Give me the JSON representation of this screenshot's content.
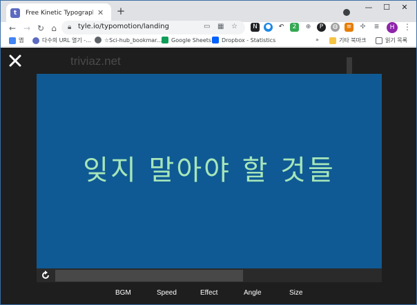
{
  "browser": {
    "tab_title": "Free Kinetic Typography Vid",
    "tab_favicon_letter": "t",
    "new_tab_label": "+",
    "url": "tyle.io/typomotion/landing",
    "avatar_letter": "H",
    "badge_count": "2"
  },
  "bookmarks": [
    {
      "label": "앱",
      "icon": "apps-icon",
      "color": "#4285f4"
    },
    {
      "label": "다수의 URL 열기 -...",
      "icon": "urls-icon",
      "color": "#5c6bc0"
    },
    {
      "label": "☆Sci-hub_bookmar...",
      "icon": "globe-icon",
      "color": "#5f6368"
    },
    {
      "label": "Google Sheets",
      "icon": "sheets-icon",
      "color": "#0f9d58"
    },
    {
      "label": "Dropbox - Statistics",
      "icon": "dropbox-icon",
      "color": "#0061fe"
    },
    {
      "label": "기타 북마크",
      "icon": "folder-icon",
      "color": "#f6c343"
    },
    {
      "label": "읽기 목록",
      "icon": "reading-list-icon",
      "color": "#5f6368"
    }
  ],
  "page": {
    "background_site": "triviaz.net",
    "stage_text": "잊지 말아야 할 것들",
    "stage_color": "#0f5a94",
    "text_color": "#a6e6b9",
    "progress_fraction": 0.58,
    "controls": [
      "BGM",
      "Speed",
      "Effect",
      "Angle",
      "Size"
    ]
  }
}
